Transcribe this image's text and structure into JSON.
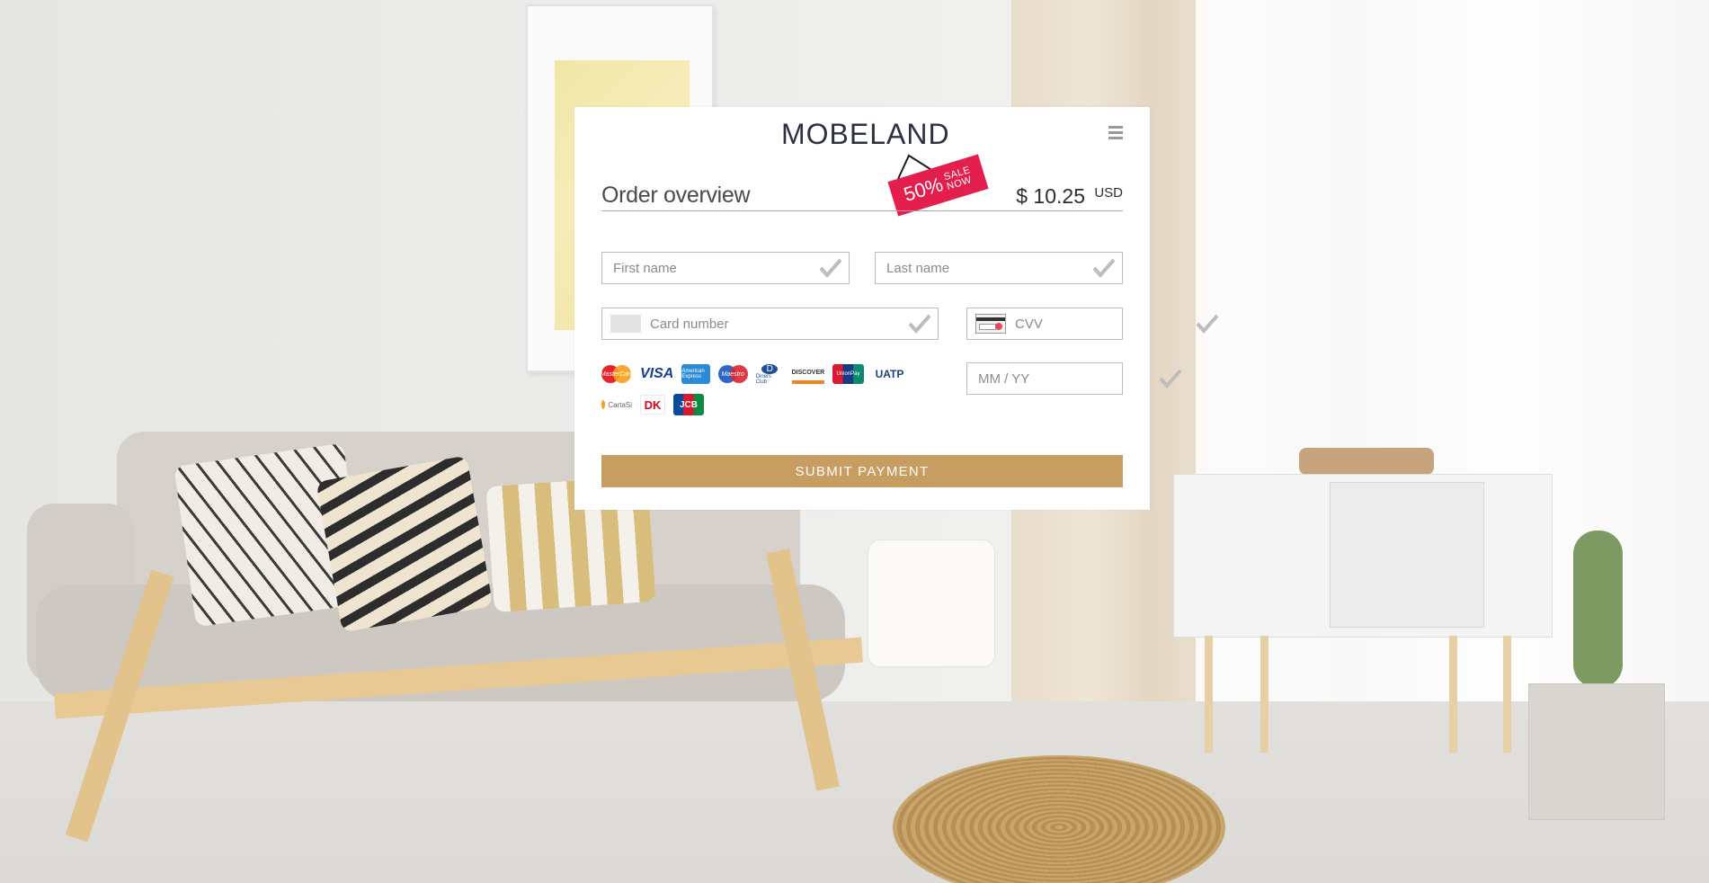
{
  "brand": {
    "name": "MOBELAND",
    "sale_percent": "50%",
    "sale_word_1": "SALE",
    "sale_word_2": "NOW"
  },
  "header": {
    "menu_icon": "hamburger-menu-icon"
  },
  "order": {
    "title": "Order overview",
    "amount": "$ 10.25",
    "currency": "USD"
  },
  "form": {
    "first_name": {
      "value": "",
      "placeholder": "First name"
    },
    "last_name": {
      "value": "",
      "placeholder": "Last name"
    },
    "card_number": {
      "value": "",
      "placeholder": "Card number"
    },
    "cvv": {
      "value": "",
      "placeholder": "CVV"
    },
    "expiry": {
      "value": "",
      "placeholder": "MM / YY"
    }
  },
  "card_brands": {
    "row1": [
      "MasterCard",
      "VISA",
      "American Express",
      "Maestro",
      "Diners Club",
      "DISCOVER",
      "UnionPay",
      "UATP"
    ],
    "row2": [
      "CartaSi",
      "DK",
      "JCB"
    ]
  },
  "submit_label": "SUBMIT PAYMENT",
  "colors": {
    "accent": "#c89d62",
    "sale_tag": "#e41f4d",
    "logo": "#2c3043",
    "check": "#bdbdbd"
  }
}
